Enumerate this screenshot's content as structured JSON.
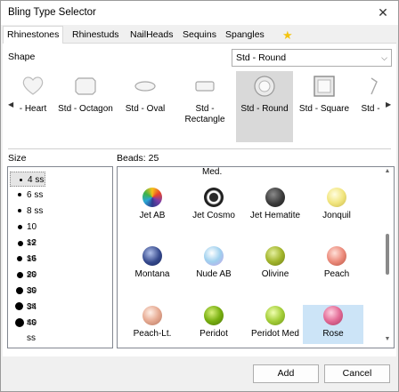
{
  "window": {
    "title": "Bling Type Selector"
  },
  "tabs": [
    {
      "label": "Rhinestones",
      "active": true
    },
    {
      "label": "Rhinestuds"
    },
    {
      "label": "NailHeads"
    },
    {
      "label": "Sequins"
    },
    {
      "label": "Spangles"
    },
    {
      "icon": "star-icon",
      "glyph": "★"
    }
  ],
  "shape": {
    "label": "Shape",
    "selected": "Std - Round",
    "items": [
      {
        "label": "- Heart",
        "icon": "heart-icon"
      },
      {
        "label": "Std - Octagon",
        "icon": "octagon-icon"
      },
      {
        "label": "Std - Oval",
        "icon": "oval-icon"
      },
      {
        "label": "Std - Rectangle",
        "icon": "rectangle-icon"
      },
      {
        "label": "Std - Round",
        "icon": "round-icon",
        "selected": true
      },
      {
        "label": "Std - Square",
        "icon": "square-icon"
      },
      {
        "label": "Std -",
        "icon": "partial-shape-icon"
      }
    ]
  },
  "size": {
    "label": "Size",
    "items": [
      "4 ss",
      "6 ss",
      "8 ss",
      "10 ss",
      "12 ss",
      "16 ss",
      "20 ss",
      "30 ss",
      "34 ss",
      "40 ss"
    ],
    "selected": "4 ss"
  },
  "beads": {
    "label": "Beads: 25",
    "group_header": "Med.",
    "items": [
      {
        "name": "Jet AB",
        "color": "#2e3a8c"
      },
      {
        "name": "Jet Cosmo",
        "color": "#2a2a2a"
      },
      {
        "name": "Jet Hematite",
        "color": "#4a4a4a"
      },
      {
        "name": "Jonquil",
        "color": "#f2e680"
      },
      {
        "name": "Montana",
        "color": "#34488c"
      },
      {
        "name": "Nude AB",
        "color": "#9fd0ee"
      },
      {
        "name": "Olivine",
        "color": "#a3b62d"
      },
      {
        "name": "Peach",
        "color": "#ec8c7d"
      },
      {
        "name": "Peach-Lt.",
        "color": "#e6aa92"
      },
      {
        "name": "Peridot",
        "color": "#79b011"
      },
      {
        "name": "Peridot Med",
        "color": "#a5cf3a"
      },
      {
        "name": "Rose",
        "color": "#e36b96",
        "selected": true
      }
    ]
  },
  "footer": {
    "add_label": "Add",
    "cancel_label": "Cancel"
  },
  "close_glyph": "✕"
}
